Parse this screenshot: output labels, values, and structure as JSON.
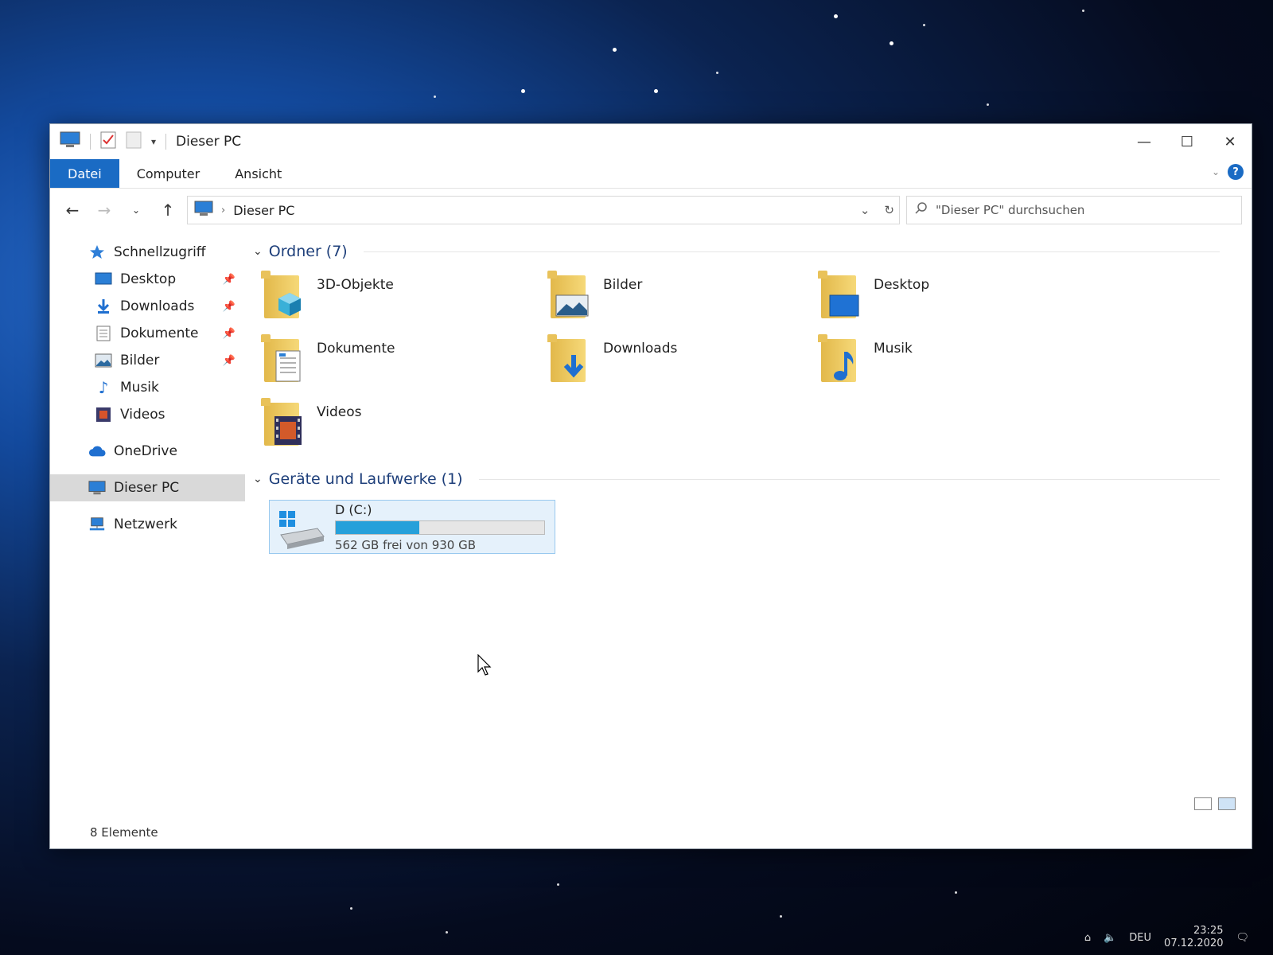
{
  "window": {
    "title": "Dieser PC",
    "controls": {
      "minimize": "—",
      "maximize": "☐",
      "close": "✕"
    }
  },
  "ribbon": {
    "tabs": [
      {
        "label": "Datei",
        "active": true
      },
      {
        "label": "Computer",
        "active": false
      },
      {
        "label": "Ansicht",
        "active": false
      }
    ],
    "help": "?"
  },
  "navigation": {
    "address": "Dieser PC",
    "search_placeholder": "\"Dieser PC\" durchsuchen"
  },
  "sidebar": {
    "quick_access": "Schnellzugriff",
    "pinned": [
      {
        "label": "Desktop",
        "icon": "desktop-icon"
      },
      {
        "label": "Downloads",
        "icon": "download-icon"
      },
      {
        "label": "Dokumente",
        "icon": "document-icon"
      },
      {
        "label": "Bilder",
        "icon": "picture-icon"
      }
    ],
    "unpinned": [
      {
        "label": "Musik",
        "icon": "music-icon"
      },
      {
        "label": "Videos",
        "icon": "video-icon"
      }
    ],
    "onedrive": "OneDrive",
    "this_pc": "Dieser PC",
    "network": "Netzwerk"
  },
  "content": {
    "folders_heading": "Ordner (7)",
    "folders": [
      {
        "label": "3D-Objekte",
        "icon": "3d-objects-icon"
      },
      {
        "label": "Bilder",
        "icon": "pictures-icon"
      },
      {
        "label": "Desktop",
        "icon": "desktop-icon"
      },
      {
        "label": "Dokumente",
        "icon": "documents-icon"
      },
      {
        "label": "Downloads",
        "icon": "downloads-icon"
      },
      {
        "label": "Musik",
        "icon": "music-icon"
      },
      {
        "label": "Videos",
        "icon": "videos-icon"
      }
    ],
    "devices_heading": "Geräte und Laufwerke (1)",
    "drive": {
      "name": "D (C:)",
      "free_text": "562 GB frei von 930 GB",
      "used_fraction": 0.4
    }
  },
  "status": {
    "items": "8 Elemente"
  },
  "taskbar": {
    "language": "DEU",
    "time": "23:25",
    "date": "07.12.2020"
  },
  "colors": {
    "accent": "#1a6bc4",
    "bar_fill": "#26a0da",
    "selection": "#d9d9d9"
  }
}
